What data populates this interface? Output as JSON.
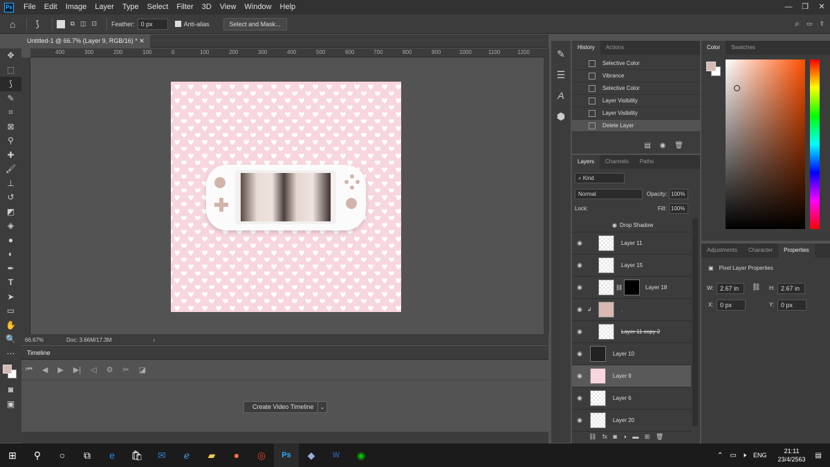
{
  "menu": [
    "File",
    "Edit",
    "Image",
    "Layer",
    "Type",
    "Select",
    "Filter",
    "3D",
    "View",
    "Window",
    "Help"
  ],
  "options": {
    "feather_label": "Feather:",
    "feather_value": "0 px",
    "antialias_label": "Anti-alias",
    "select_mask": "Select and Mask..."
  },
  "doc_tab": "Untitled-1 @ 66.7% (Layer 9, RGB/16) *",
  "ruler_h": [
    "400",
    "300",
    "200",
    "100",
    "0",
    "100",
    "200",
    "300",
    "400",
    "500",
    "600",
    "700",
    "800",
    "900",
    "1000",
    "1100",
    "1200"
  ],
  "status": {
    "zoom": "66.67%",
    "doc": "Doc: 3.66M/17.3M"
  },
  "timeline": {
    "title": "Timeline",
    "create_button": "Create Video Timeline"
  },
  "history": {
    "tabs": [
      "History",
      "Actions"
    ],
    "items": [
      "Selective Color",
      "Vibrance",
      "Selective Color",
      "Layer Visibility",
      "Layer Visibility",
      "Delete Layer"
    ]
  },
  "layers": {
    "tabs": [
      "Layers",
      "Channels",
      "Paths"
    ],
    "kind": "Kind",
    "blend": "Normal",
    "opacity_label": "Opacity:",
    "opacity": "100%",
    "lock_label": "Lock:",
    "fill_label": "Fill:",
    "fill": "100%",
    "items": [
      "Drop Shadow",
      "Layer 11",
      "Layer 15",
      "Layer 18",
      ".",
      "Layer 11 copy 2",
      "Layer 10",
      "Layer 9",
      "Layer 6",
      "Layer 20"
    ]
  },
  "color": {
    "tabs": [
      "Color",
      "Swatches"
    ],
    "foreground": "#d7b9b2"
  },
  "properties": {
    "tabs": [
      "Adjustments",
      "Character",
      "Properties"
    ],
    "title": "Pixel Layer Properties",
    "w_label": "W:",
    "w": "2.67 in",
    "h_label": "H:",
    "h": "2.67 in",
    "x_label": "X:",
    "x": "0 px",
    "y_label": "Y:",
    "y": "0 px"
  },
  "taskbar": {
    "lang": "ENG",
    "time": "21:11",
    "date": "23/4/2563"
  }
}
